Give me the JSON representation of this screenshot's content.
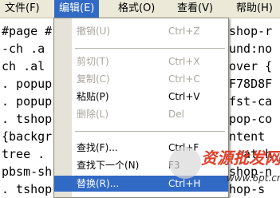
{
  "menubar": {
    "items": [
      {
        "label": "文件(F)"
      },
      {
        "label": "编辑(E)"
      },
      {
        "label": "格式(O)"
      },
      {
        "label": "查看(V)"
      },
      {
        "label": "帮助(H)"
      }
    ]
  },
  "editor": {
    "lines": [
      "#page #",
      "-ch .a",
      "ch .al",
      ". popup-",
      ". popup-",
      ". tshop-",
      "{backgr",
      "tree .",
      "pbsm-sh",
      ". tshop-"
    ],
    "right_lines": [
      "shop-r",
      "und:no",
      "over {",
      "F78D8F",
      "fst-ca",
      "pop-co",
      "ntent",
      "-cat-h",
      "shop-n",
      "hop-s"
    ]
  },
  "edit_menu": {
    "undo": {
      "label": "撤销(U)",
      "shortcut": "Ctrl+Z"
    },
    "cut": {
      "label": "剪切(T)",
      "shortcut": "Ctrl+X"
    },
    "copy": {
      "label": "复制(C)",
      "shortcut": "Ctrl+C"
    },
    "paste": {
      "label": "粘贴(P)",
      "shortcut": "Ctrl+V"
    },
    "delete": {
      "label": "删除(L)",
      "shortcut": "Del"
    },
    "find": {
      "label": "查找(F)...",
      "shortcut": "Ctrl+F"
    },
    "find_next": {
      "label": "查找下一个(N)",
      "shortcut": "F3"
    },
    "replace": {
      "label": "替换(R)...",
      "shortcut": "Ctrl+H"
    }
  },
  "watermark": {
    "text": "资源批发网",
    "site": "www.6pt.cn"
  },
  "colors": {
    "menu_highlight": "#316ac5",
    "menubar_bg": "#ece9d8",
    "disabled_text": "#a9a69b"
  }
}
